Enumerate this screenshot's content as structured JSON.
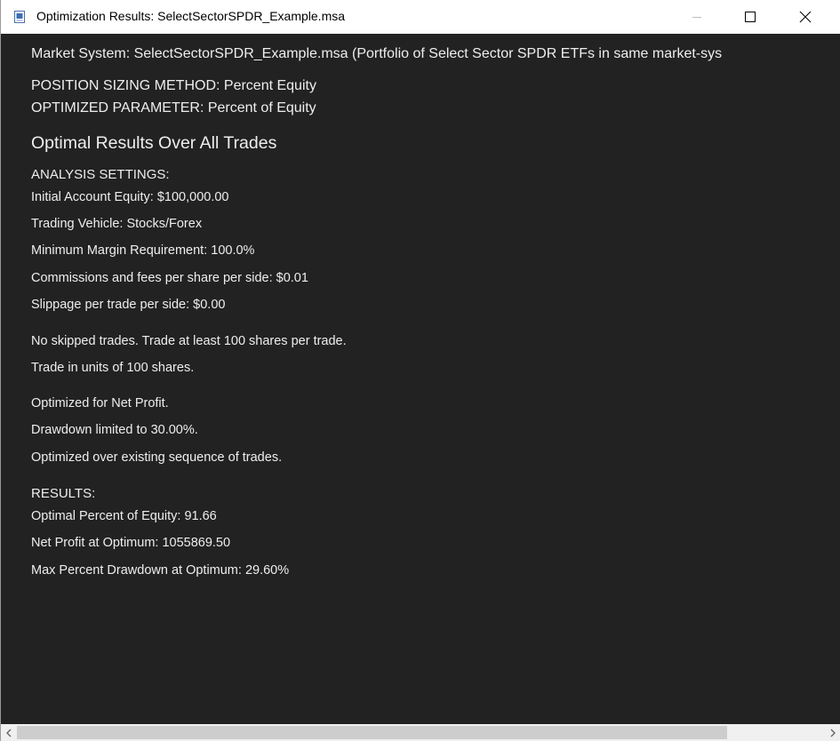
{
  "window": {
    "title": "Optimization Results: SelectSectorSPDR_Example.msa",
    "icon": "document-icon",
    "controls": [
      "minimize-icon",
      "maximize-icon",
      "close-icon"
    ]
  },
  "report": {
    "market_system": "Market System: SelectSectorSPDR_Example.msa (Portfolio of Select Sector SPDR ETFs in same market-sys",
    "sizing_method": "POSITION SIZING METHOD:   Percent Equity",
    "optimized_parameter": "OPTIMIZED PARAMETER:   Percent of Equity",
    "section_title": "Optimal Results Over All Trades",
    "analysis_heading": "ANALYSIS SETTINGS:",
    "initial_equity": "Initial Account Equity: $100,000.00",
    "trading_vehicle": "Trading Vehicle: Stocks/Forex",
    "min_margin": "Minimum Margin Requirement: 100.0%",
    "commissions": "Commissions and fees per share per side: $0.01",
    "slippage": "Slippage per trade per side: $0.00",
    "skipped_trades": "No skipped trades. Trade at least 100 shares per trade.",
    "trade_units": "Trade in units of 100 shares.",
    "optimized_for": "Optimized for Net Profit.",
    "drawdown_limit": "Drawdown limited to 30.00%.",
    "sequence_note": "Optimized over existing sequence of trades.",
    "results_heading": "RESULTS:",
    "optimal_percent": "Optimal Percent of Equity: 91.66",
    "net_profit": "Net Profit at Optimum: 1055869.50",
    "max_drawdown": "Max Percent Drawdown at Optimum: 29.60%"
  },
  "colors": {
    "content_background": "#222222",
    "content_text": "#eeeeee",
    "titlebar_background": "#ffffff",
    "scrollbar_track": "#f0f0f0",
    "scrollbar_thumb": "#cdcdcd"
  },
  "scrollbar": {
    "visible_fraction": 0.88
  }
}
